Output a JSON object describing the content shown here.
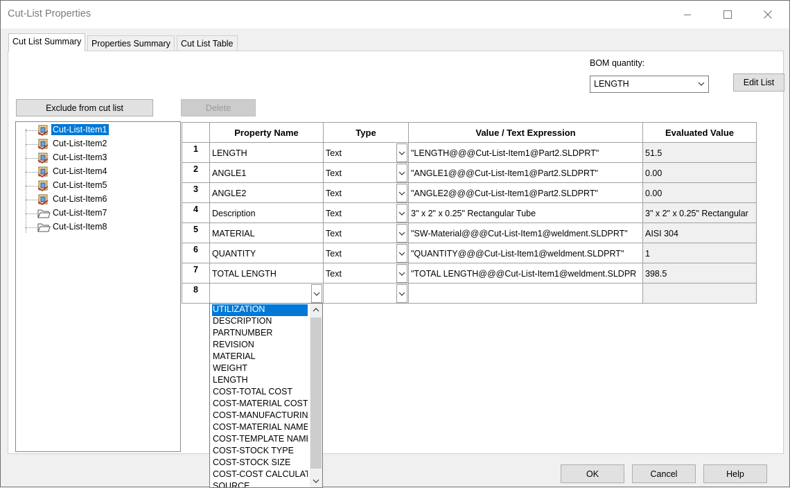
{
  "window": {
    "title": "Cut-List Properties"
  },
  "tabs": [
    {
      "label": "Cut List Summary"
    },
    {
      "label": "Properties Summary"
    },
    {
      "label": "Cut List Table"
    }
  ],
  "bom": {
    "label": "BOM quantity:",
    "value": "LENGTH",
    "edit_list_label": "Edit List"
  },
  "toolbar": {
    "exclude_label": "Exclude from cut list",
    "delete_label": "Delete"
  },
  "tree": {
    "items": [
      {
        "label": "Cut-List-Item1",
        "icon": "weldment-icon"
      },
      {
        "label": "Cut-List-Item2",
        "icon": "weldment-icon"
      },
      {
        "label": "Cut-List-Item3",
        "icon": "weldment-icon"
      },
      {
        "label": "Cut-List-Item4",
        "icon": "weldment-icon"
      },
      {
        "label": "Cut-List-Item5",
        "icon": "weldment-icon"
      },
      {
        "label": "Cut-List-Item6",
        "icon": "weldment-icon"
      },
      {
        "label": "Cut-List-Item7",
        "icon": "folder-icon"
      },
      {
        "label": "Cut-List-Item8",
        "icon": "folder-icon"
      }
    ]
  },
  "table": {
    "headers": [
      "Property Name",
      "Type",
      "Value / Text Expression",
      "Evaluated Value"
    ],
    "rows": [
      {
        "num": "1",
        "name": "LENGTH",
        "type": "Text",
        "value": "\"LENGTH@@@Cut-List-Item1@Part2.SLDPRT\"",
        "evaluated": "51.5"
      },
      {
        "num": "2",
        "name": "ANGLE1",
        "type": "Text",
        "value": "\"ANGLE1@@@Cut-List-Item1@Part2.SLDPRT\"",
        "evaluated": "0.00"
      },
      {
        "num": "3",
        "name": "ANGLE2",
        "type": "Text",
        "value": "\"ANGLE2@@@Cut-List-Item1@Part2.SLDPRT\"",
        "evaluated": "0.00"
      },
      {
        "num": "4",
        "name": "Description",
        "type": "Text",
        "value": "3\" x 2\" x 0.25\" Rectangular Tube",
        "evaluated": "3\" x 2\" x 0.25\" Rectangular"
      },
      {
        "num": "5",
        "name": "MATERIAL",
        "type": "Text",
        "value": "\"SW-Material@@@Cut-List-Item1@weldment.SLDPRT\"",
        "evaluated": "AISI 304"
      },
      {
        "num": "6",
        "name": "QUANTITY",
        "type": "Text",
        "value": "\"QUANTITY@@@Cut-List-Item1@weldment.SLDPRT\"",
        "evaluated": "1"
      },
      {
        "num": "7",
        "name": "TOTAL LENGTH",
        "type": "Text",
        "value": "\"TOTAL LENGTH@@@Cut-List-Item1@weldment.SLDPR",
        "evaluated": "398.5"
      },
      {
        "num": "8",
        "name": "",
        "type": "",
        "value": "",
        "evaluated": ""
      }
    ]
  },
  "dropdown": {
    "options": [
      "UTILIZATION",
      "DESCRIPTION",
      "PARTNUMBER",
      "REVISION",
      "MATERIAL",
      "WEIGHT",
      "LENGTH",
      "COST-TOTAL COST",
      "COST-MATERIAL COST",
      "COST-MANUFACTURING",
      "COST-MATERIAL NAME",
      "COST-TEMPLATE NAME",
      "COST-STOCK TYPE",
      "COST-STOCK SIZE",
      "COST-COST CALCULATION",
      "SOURCE"
    ],
    "selected": "UTILIZATION"
  },
  "footer": {
    "ok_label": "OK",
    "cancel_label": "Cancel",
    "help_label": "Help"
  }
}
